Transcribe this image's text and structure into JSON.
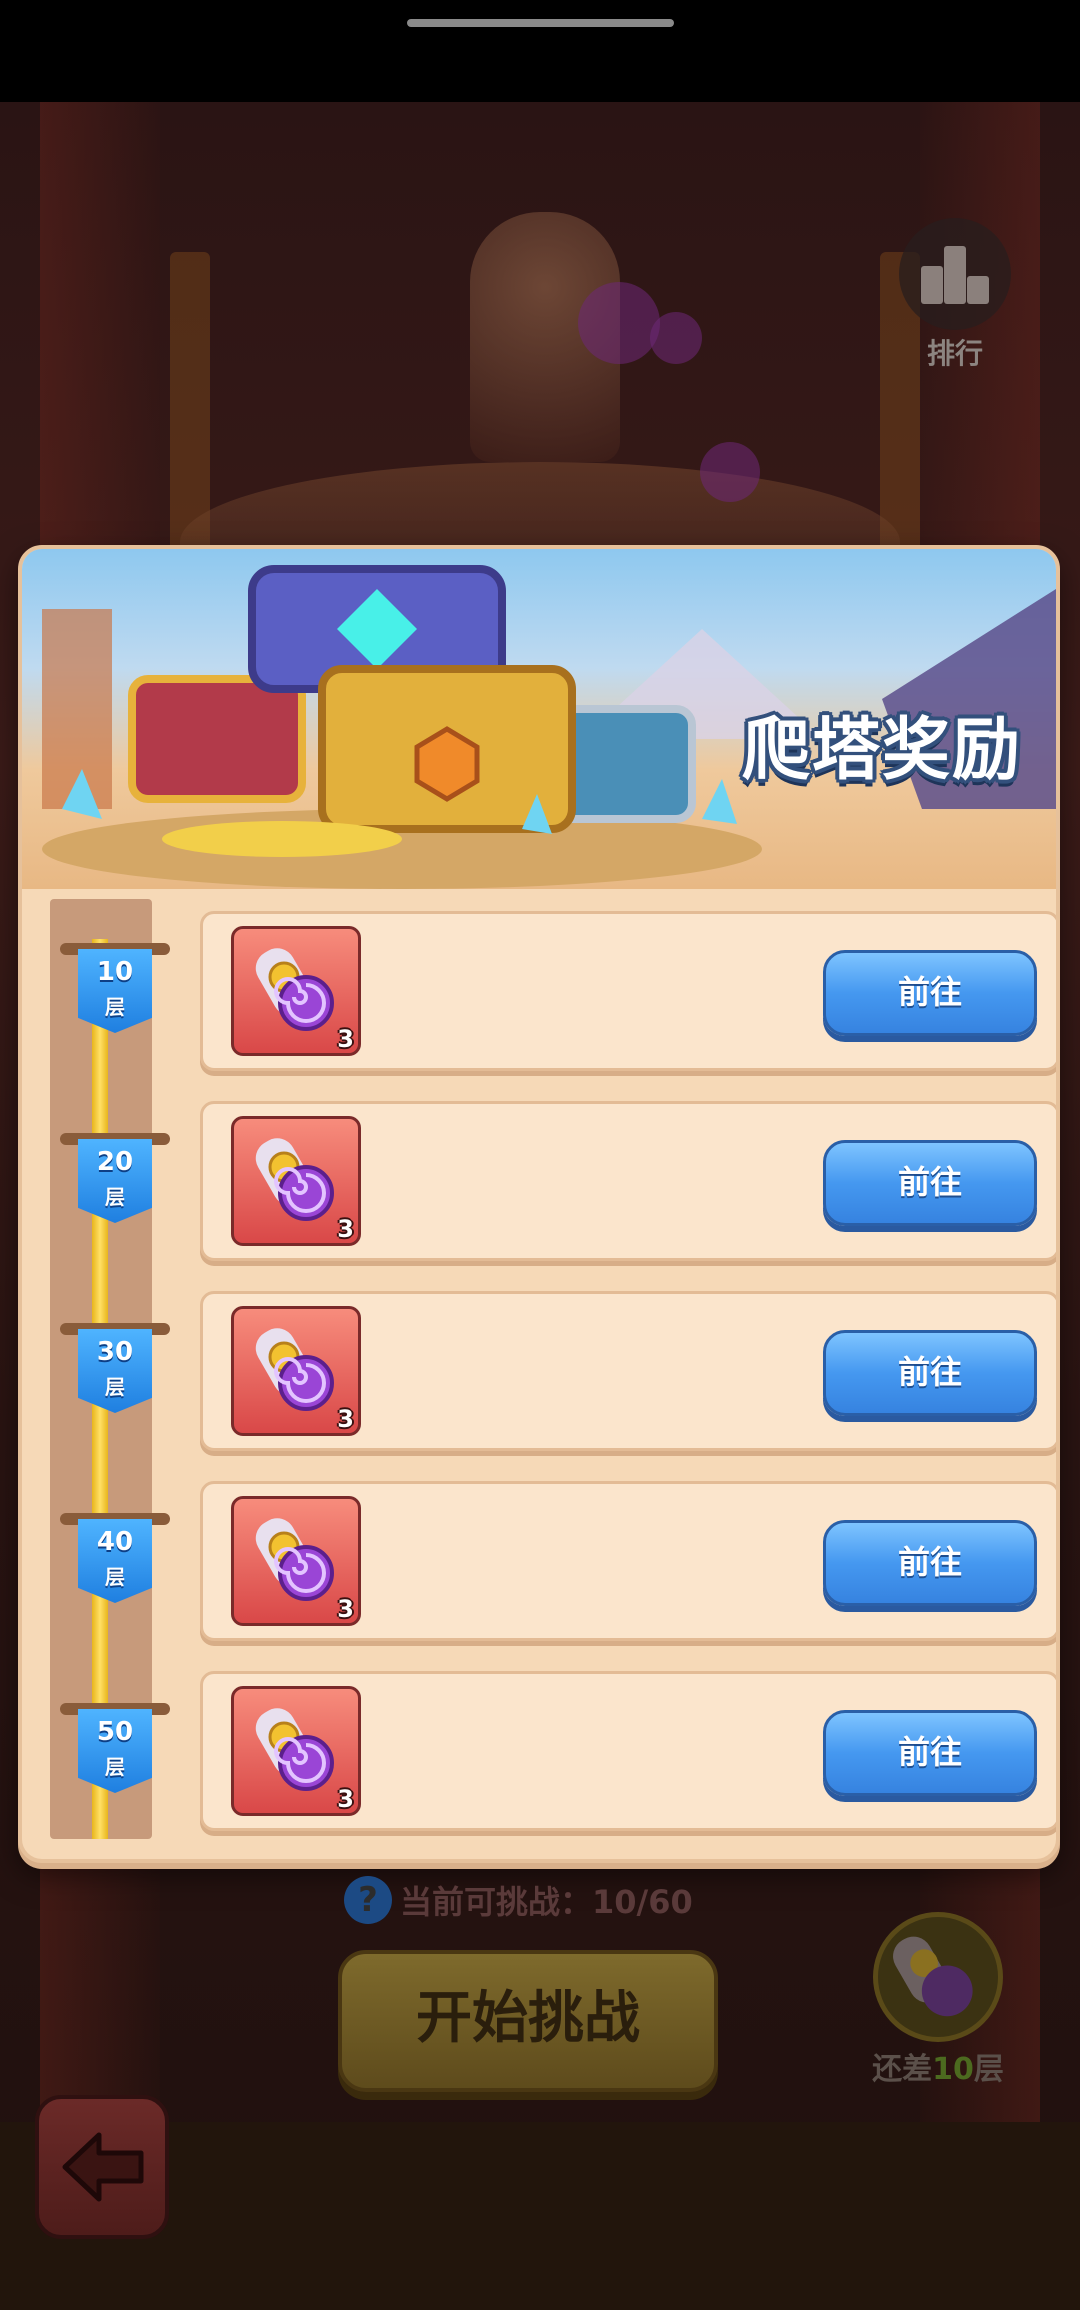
{
  "header": {
    "rank_label": "排行"
  },
  "modal": {
    "title": "爬塔奖励",
    "rows": [
      {
        "floor_num": "10",
        "floor_unit": "层",
        "reward_count": "3",
        "button_label": "前往"
      },
      {
        "floor_num": "20",
        "floor_unit": "层",
        "reward_count": "3",
        "button_label": "前往"
      },
      {
        "floor_num": "30",
        "floor_unit": "层",
        "reward_count": "3",
        "button_label": "前往"
      },
      {
        "floor_num": "40",
        "floor_unit": "层",
        "reward_count": "3",
        "button_label": "前往"
      },
      {
        "floor_num": "50",
        "floor_unit": "层",
        "reward_count": "3",
        "button_label": "前往"
      }
    ]
  },
  "footer": {
    "challenge_label": "当前可挑战：10/60",
    "help_icon": "?",
    "start_button": "开始挑战",
    "remaining_prefix": "还差",
    "remaining_value": "10",
    "remaining_suffix": "层"
  },
  "icons": {
    "rank": "podium-icon",
    "reward": "scroll-icon",
    "back": "arrow-left-icon",
    "help": "question-icon"
  },
  "colors": {
    "accent_blue": "#4598f0",
    "panel": "#f6d9b7",
    "reward_tile": "#e35b55",
    "title_outline": "#33507c"
  }
}
